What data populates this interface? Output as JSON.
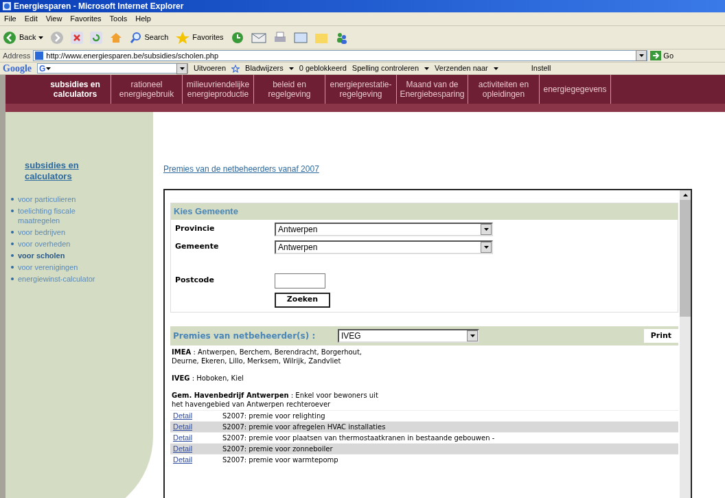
{
  "window": {
    "title": "Energiesparen - Microsoft Internet Explorer"
  },
  "menu": [
    "File",
    "Edit",
    "View",
    "Favorites",
    "Tools",
    "Help"
  ],
  "toolbar": {
    "back": "Back",
    "search": "Search",
    "favorites": "Favorites"
  },
  "address": {
    "label": "Address",
    "url": "http://www.energiesparen.be/subsidies/scholen.php",
    "go": "Go"
  },
  "google_bar": {
    "logo": "Google",
    "g": "G",
    "run": "Uitvoeren",
    "bookmarks": "Bladwijzers",
    "blocked": "0 geblokkeerd",
    "spelling": "Spelling controleren",
    "send": "Verzenden naar",
    "settings": "Instell"
  },
  "nav": [
    {
      "label": "subsidies en calculators",
      "selected": true
    },
    {
      "label": "rationeel energiegebruik",
      "selected": false
    },
    {
      "label": "milieuvriendelijke energieproductie",
      "selected": false
    },
    {
      "label": "beleid en regelgeving",
      "selected": false
    },
    {
      "label": "energieprestatie-regelgeving",
      "selected": false
    },
    {
      "label": "Maand van de Energiebesparing",
      "selected": false
    },
    {
      "label": "activiteiten en opleidingen",
      "selected": false
    },
    {
      "label": "energiegegevens",
      "selected": false
    }
  ],
  "sidebar": {
    "title": "subsidies en calculators",
    "items": [
      {
        "label": "voor particulieren",
        "selected": false
      },
      {
        "label": "toelichting fiscale maatregelen",
        "selected": false
      },
      {
        "label": "voor bedrijven",
        "selected": false
      },
      {
        "label": "voor overheden",
        "selected": false
      },
      {
        "label": "voor scholen",
        "selected": true
      },
      {
        "label": "voor verenigingen",
        "selected": false
      },
      {
        "label": "energiewinst-calculator",
        "selected": false
      }
    ]
  },
  "main": {
    "link": "Premies van de netbeheerders vanaf 2007",
    "kies": {
      "title": "Kies Gemeente",
      "provincie_label": "Provincie",
      "provincie": "Antwerpen",
      "gemeente_label": "Gemeente",
      "gemeente": "Antwerpen",
      "postcode_label": "Postcode",
      "search": "Zoeken"
    },
    "premies": {
      "title": "Premies van netbeheerder(s) :",
      "selected": "IVEG",
      "print": "Print",
      "groups": [
        [
          "**IMEA** : Antwerpen, Berchem, Berendracht, Borgerhout,",
          "Deurne, Ekeren, Lillo, Merksem, Wilrijk, Zandvliet"
        ],
        [
          "**IVEG** : Hoboken, Kiel"
        ],
        [
          "**Gem. Havenbedrijf Antwerpen** : Enkel voor bewoners uit",
          "het havengebied van Antwerpen rechteroever"
        ]
      ],
      "rows": [
        {
          "link": "Detail",
          "text": "S2007: premie voor relighting"
        },
        {
          "link": "Detail",
          "text": "S2007: premie voor afregelen HVAC installaties"
        },
        {
          "link": "Detail",
          "text": "S2007: premie voor plaatsen van thermostaatkranen in bestaande gebouwen -"
        },
        {
          "link": "Detail",
          "text": "S2007: premie voor zonneboiler"
        },
        {
          "link": "Detail",
          "text": "S2007: premie voor warmtepomp"
        }
      ]
    }
  }
}
